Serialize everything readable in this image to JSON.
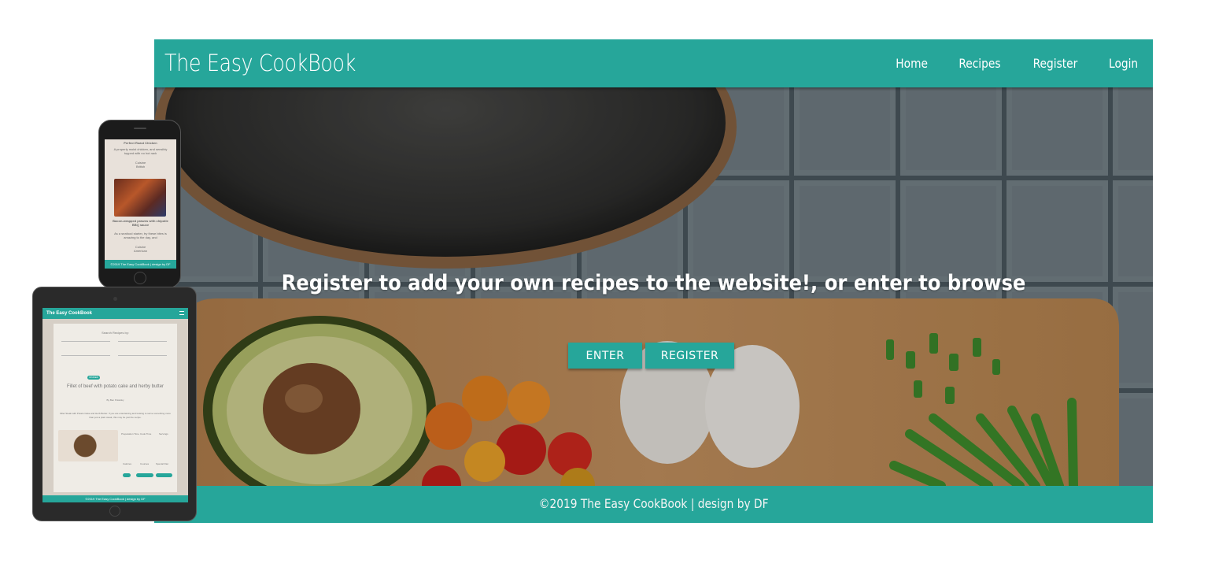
{
  "navbar": {
    "brand": "The Easy CookBook",
    "links": [
      "Home",
      "Recipes",
      "Register",
      "Login"
    ]
  },
  "hero": {
    "tagline": "Register to add your own recipes to the website!, or enter to browse",
    "enter_label": "ENTER",
    "register_label": "REGISTER"
  },
  "footer": {
    "text": "©2019 The Easy CookBook | design by DF"
  },
  "phone": {
    "recipe_title_top": "Perfect Roast Chicken",
    "recipe_desc_top": "A properly moist chicken, and sensibly topped with no hot rack",
    "cuisine_label": "Cuisine",
    "cuisine_value": "British",
    "recipe_title": "Bacon-wrapped prawns with chipotle BBQ sauce",
    "recipe_desc": "As a seafood starter, try these bites is amazing to the day, and",
    "cuisine_value_2": "American",
    "footer": "©2019 The Easy CookBook | design by DF"
  },
  "tablet": {
    "brand": "The Easy CookBook",
    "search_heading": "Search Recipes by:",
    "badge": "DINNER",
    "recipe_title": "Fillet of beef with potato cake and herby butter",
    "author": "By Ben Polarsky",
    "description": "Fillet Steak with Potato Cake and Herb Butter. If you are entertaining and looking to serve something more than just a plain steak, this may be just the recipe.",
    "stat_labels": [
      "Preparation Time",
      "Cook Time",
      "Servings"
    ],
    "meta_labels": [
      "Calories",
      "Courses",
      "Special Diet"
    ],
    "footer": "©2019 The Easy CookBook | design by DF"
  },
  "colors": {
    "accent": "#26a69a",
    "white": "#ffffff"
  }
}
